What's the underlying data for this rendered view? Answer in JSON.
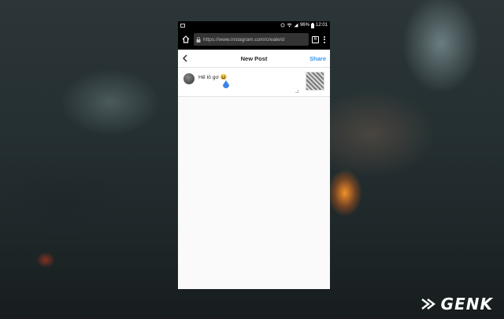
{
  "status_bar": {
    "battery": "96%",
    "time": "12:01"
  },
  "browser": {
    "url": "https://www.instagram.com/create/d",
    "tab_count": "6"
  },
  "header": {
    "title": "New Post",
    "share_label": "Share"
  },
  "post": {
    "caption": "Hế lô gơ",
    "caption_emoji": "😆"
  },
  "colors": {
    "accent": "#3897f0",
    "cursor_handle": "#3b83e4"
  },
  "watermark": {
    "text": "GENK"
  }
}
